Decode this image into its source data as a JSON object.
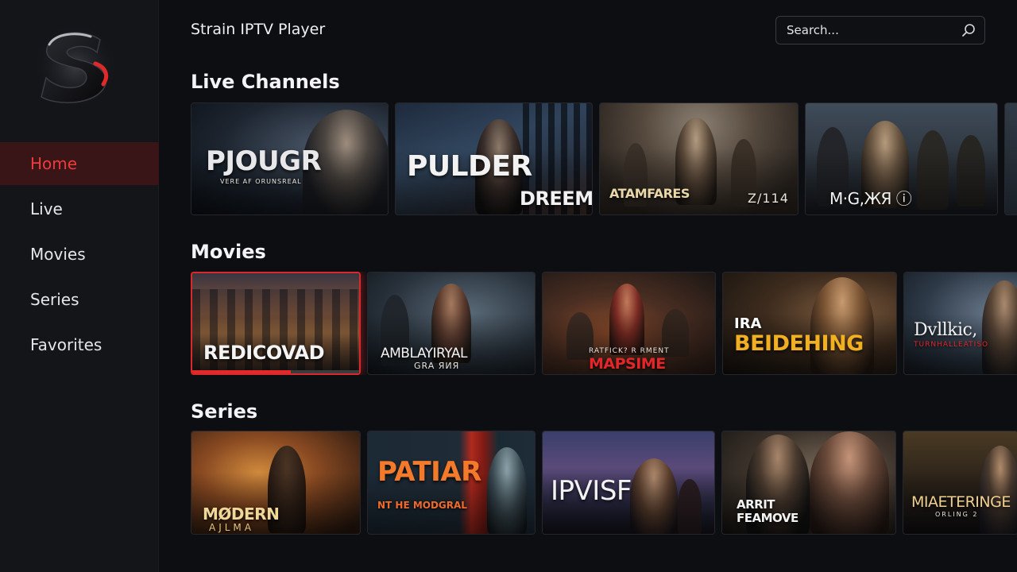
{
  "app": {
    "title": "Strain IPTV Player",
    "logo_icon": "s-logo-icon",
    "accent": "#e12a2a"
  },
  "search": {
    "placeholder": "Search...",
    "value": "",
    "icon": "search-icon"
  },
  "sidebar": {
    "items": [
      {
        "label": "Home",
        "active": true
      },
      {
        "label": "Live",
        "active": false
      },
      {
        "label": "Movies",
        "active": false
      },
      {
        "label": "Series",
        "active": false
      },
      {
        "label": "Favorites",
        "active": false
      }
    ]
  },
  "sections": {
    "live": {
      "title": "Live Channels",
      "cards": [
        {
          "title": "PJOUGR",
          "subtitle": "VERE AF ORUNSREAL"
        },
        {
          "title": "PULDER",
          "subtitle": "DREEMTS"
        },
        {
          "title": "ATAMFARES",
          "subtitle": "Z/114"
        },
        {
          "title": "M·G,ЖЯ ⓘ",
          "subtitle": ""
        }
      ]
    },
    "movies": {
      "title": "Movies",
      "cards": [
        {
          "title": "REDICOVAD",
          "subtitle": "",
          "progress": 0.59
        },
        {
          "title": "AMBLAYIRYAL",
          "subtitle": "GRA ЯИЯ"
        },
        {
          "title": "MAPSIME",
          "subtitle": "RATFICK? R RMENT"
        },
        {
          "title": "BEIDEHING",
          "subtitle": "IRA"
        },
        {
          "title": "Dvllkic,",
          "subtitle": "TURNHALLEATISO"
        }
      ]
    },
    "series": {
      "title": "Series",
      "cards": [
        {
          "title": "MØDERN",
          "subtitle": "AJLMA"
        },
        {
          "title": "PATIAR",
          "subtitle": "NT HE MODGRAL"
        },
        {
          "title": "IPVISF",
          "subtitle": ""
        },
        {
          "title": "ARRIT FEAMOVE",
          "subtitle": ""
        },
        {
          "title": "MIAETERINGE",
          "subtitle": "ORLING 2"
        }
      ]
    }
  }
}
